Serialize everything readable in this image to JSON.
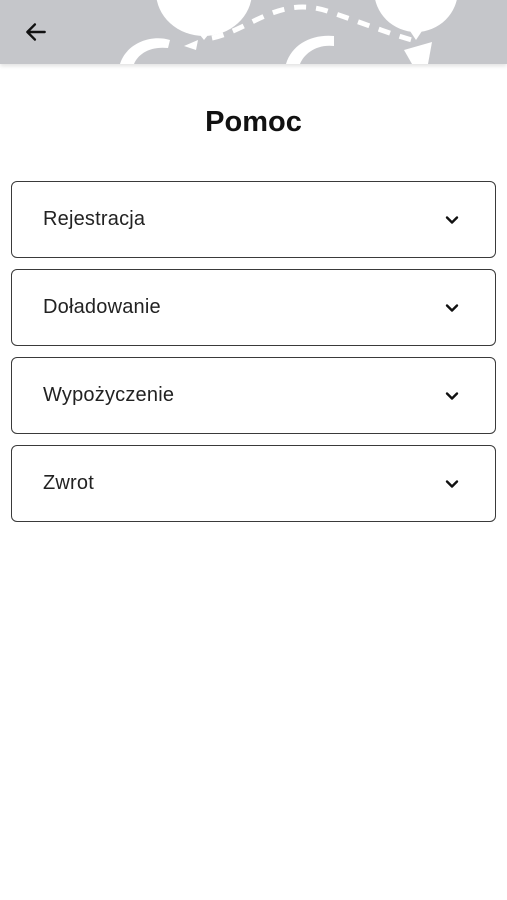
{
  "header": {
    "back_icon": "arrow-left-icon",
    "background_color": "#c5c6ca"
  },
  "page": {
    "title": "Pomoc"
  },
  "faq": {
    "items": [
      {
        "label": "Rejestracja",
        "icon": "chevron-down-icon"
      },
      {
        "label": "Doładowanie",
        "icon": "chevron-down-icon"
      },
      {
        "label": "Wypożyczenie",
        "icon": "chevron-down-icon"
      },
      {
        "label": "Zwrot",
        "icon": "chevron-down-icon"
      }
    ]
  }
}
